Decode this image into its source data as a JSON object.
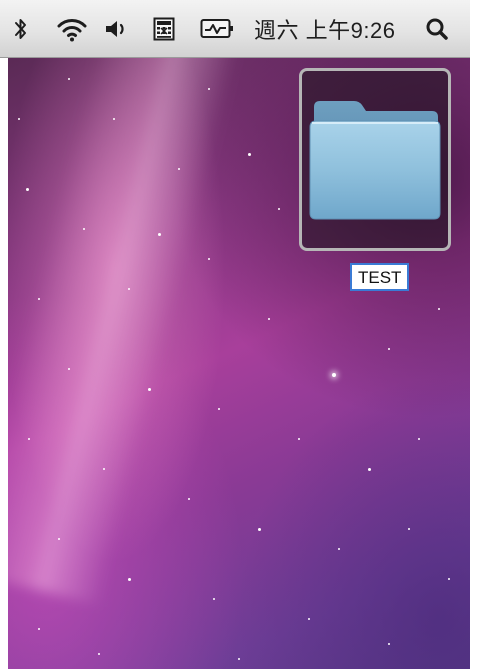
{
  "menubar": {
    "icons": [
      "bluetooth-icon",
      "wifi-icon",
      "volume-icon",
      "keyboard-input-icon",
      "activity-monitor-icon",
      "spotlight-search-icon"
    ],
    "clock": "週六 上午9:26"
  },
  "desktop": {
    "folder": {
      "name": "TEST",
      "icon": "folder-icon",
      "selected": true
    }
  },
  "colors": {
    "folder_blue": "#8fc0dc",
    "selection_border": "#b6b6b6",
    "label_border": "#3a7bd5"
  }
}
